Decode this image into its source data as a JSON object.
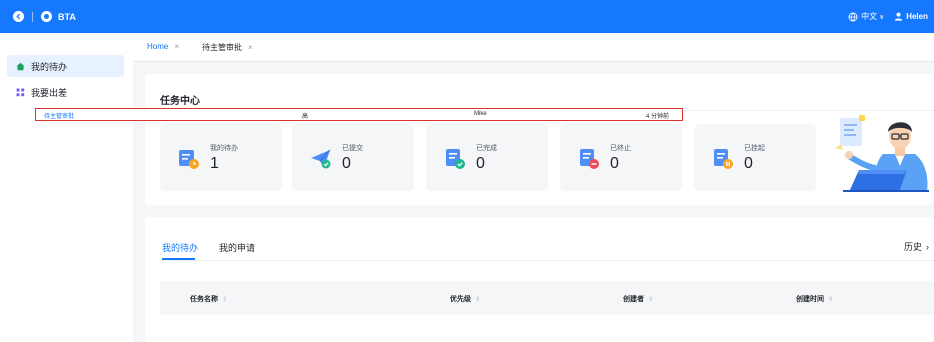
{
  "topbar": {
    "brand": "BTA",
    "language": "中文",
    "language_caret": "∨",
    "user": "Helen"
  },
  "sidebar": {
    "items": [
      {
        "label": "我的待办",
        "icon": "home-icon",
        "active": true
      },
      {
        "label": "我要出差",
        "icon": "apps-grid-icon",
        "active": false
      }
    ]
  },
  "tabs": [
    {
      "label": "Home",
      "close": "×"
    },
    {
      "label": "待主管审批",
      "close": "×"
    }
  ],
  "task_center": {
    "title": "任务中心",
    "stats": [
      {
        "label": "我的待办",
        "value": "1",
        "icon": "todo-doc-icon"
      },
      {
        "label": "已提交",
        "value": "0",
        "icon": "paper-plane-icon"
      },
      {
        "label": "已完成",
        "value": "0",
        "icon": "done-doc-icon"
      },
      {
        "label": "已终止",
        "value": "0",
        "icon": "terminated-doc-icon"
      },
      {
        "label": "已挂起",
        "value": "0",
        "icon": "suspended-doc-icon"
      }
    ]
  },
  "tasks": {
    "tabs": [
      "我的待办",
      "我的申请"
    ],
    "history": "历史",
    "history_chevron": "›",
    "columns": [
      "任务名称",
      "优先级",
      "创建者",
      "创建时间"
    ],
    "sort_glyph": "⇕",
    "rows": [
      {
        "name": "待主管审批",
        "priority": "高",
        "creator": "Mike",
        "time": "4 分钟前"
      }
    ]
  },
  "colors": {
    "primary": "#1677ff",
    "highlight_border": "#e03131",
    "page_bg": "#f5f6f8"
  }
}
